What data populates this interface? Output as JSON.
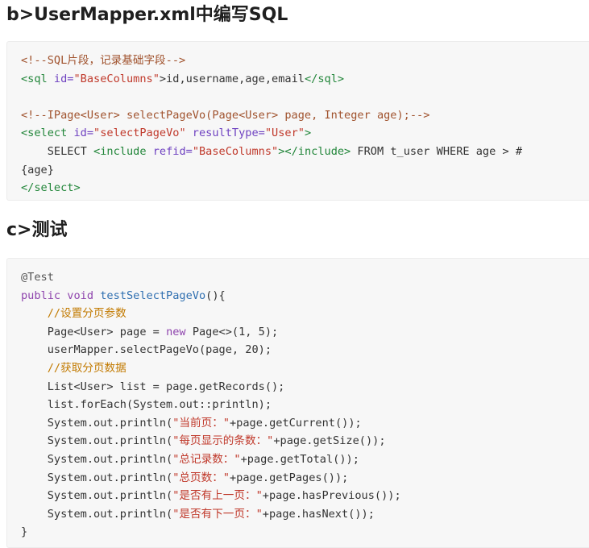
{
  "sections": [
    {
      "heading": "b>UserMapper.xml中编写SQL",
      "code": [
        [
          [
            "<!--SQL片段，记录基础字段-->",
            "comment"
          ]
        ],
        [
          [
            "<sql ",
            "tag"
          ],
          [
            "id=",
            "attr"
          ],
          [
            "\"BaseColumns\"",
            "str"
          ],
          [
            ">id,username,age,email",
            "plain"
          ],
          [
            "</sql>",
            "tag"
          ]
        ],
        [],
        [
          [
            "<!--IPage<User> selectPageVo(Page<User> page, Integer age);-->",
            "comment"
          ]
        ],
        [
          [
            "<select ",
            "tag"
          ],
          [
            "id=",
            "attr"
          ],
          [
            "\"selectPageVo\"",
            "str"
          ],
          [
            " resultType=",
            "attr"
          ],
          [
            "\"User\"",
            "str"
          ],
          [
            ">",
            "tag"
          ]
        ],
        [
          [
            "    SELECT ",
            "plain"
          ],
          [
            "<include ",
            "tag"
          ],
          [
            "refid=",
            "attr"
          ],
          [
            "\"BaseColumns\"",
            "str"
          ],
          [
            "></include>",
            "tag"
          ],
          [
            " FROM t_user WHERE age > #",
            "plain"
          ]
        ],
        [
          [
            "{age}",
            "plain"
          ]
        ],
        [
          [
            "</select>",
            "tag"
          ]
        ]
      ]
    },
    {
      "heading": "c>测试",
      "code": [
        [
          [
            "@Test",
            "ann"
          ]
        ],
        [
          [
            "public void ",
            "kw"
          ],
          [
            "testSelectPageVo",
            "fn"
          ],
          [
            "(){",
            "plain"
          ]
        ],
        [
          [
            "    //设置分页参数",
            "jcomment"
          ]
        ],
        [
          [
            "    Page<User> page = ",
            "plain"
          ],
          [
            "new ",
            "kw"
          ],
          [
            "Page<>(1, 5);",
            "plain"
          ]
        ],
        [
          [
            "    userMapper.selectPageVo(page, 20);",
            "plain"
          ]
        ],
        [
          [
            "    //获取分页数据",
            "jcomment"
          ]
        ],
        [
          [
            "    List<User> list = page.getRecords();",
            "plain"
          ]
        ],
        [
          [
            "    list.forEach(System.out::println);",
            "plain"
          ]
        ],
        [
          [
            "    System.out.println(",
            "plain"
          ],
          [
            "\"当前页：\"",
            "str"
          ],
          [
            "+page.getCurrent());",
            "plain"
          ]
        ],
        [
          [
            "    System.out.println(",
            "plain"
          ],
          [
            "\"每页显示的条数：\"",
            "str"
          ],
          [
            "+page.getSize());",
            "plain"
          ]
        ],
        [
          [
            "    System.out.println(",
            "plain"
          ],
          [
            "\"总记录数：\"",
            "str"
          ],
          [
            "+page.getTotal());",
            "plain"
          ]
        ],
        [
          [
            "    System.out.println(",
            "plain"
          ],
          [
            "\"总页数：\"",
            "str"
          ],
          [
            "+page.getPages());",
            "plain"
          ]
        ],
        [
          [
            "    System.out.println(",
            "plain"
          ],
          [
            "\"是否有上一页：\"",
            "str"
          ],
          [
            "+page.hasPrevious());",
            "plain"
          ]
        ],
        [
          [
            "    System.out.println(",
            "plain"
          ],
          [
            "\"是否有下一页：\"",
            "str"
          ],
          [
            "+page.hasNext());",
            "plain"
          ]
        ],
        [
          [
            "}",
            "plain"
          ]
        ]
      ]
    }
  ]
}
